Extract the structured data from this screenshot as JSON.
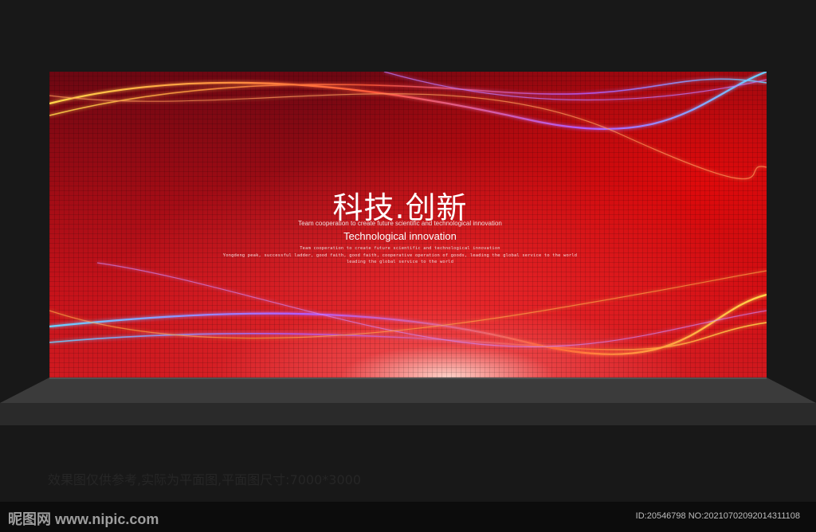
{
  "backdrop": {
    "headline": "科技.创新",
    "subtitle_small": "Team cooperation to create future scientific and technological innovation",
    "subtitle_large": "Technological innovation",
    "small_lines": [
      "Team cooperation to create future scientific and technological innovation",
      "Yongdeng peak, successful ladder, good faith, good faith, cooperative operation of goods, leading the global service to the world",
      "leading the global service to the world"
    ],
    "colors": {
      "primary_red": "#c5121a",
      "dark_red": "#6c0712",
      "light_yellow": "#ffd84a",
      "light_blue": "#6ad2ff",
      "light_violet": "#b25cff"
    }
  },
  "stage_note": "效果图仅供参考,实际为平面图,平面图尺寸:7000*3000",
  "watermark": {
    "brand_cn": "昵图网",
    "brand_url": "www.nipic.com",
    "id_text": "ID:20546798 NO:20210702092014311108"
  }
}
